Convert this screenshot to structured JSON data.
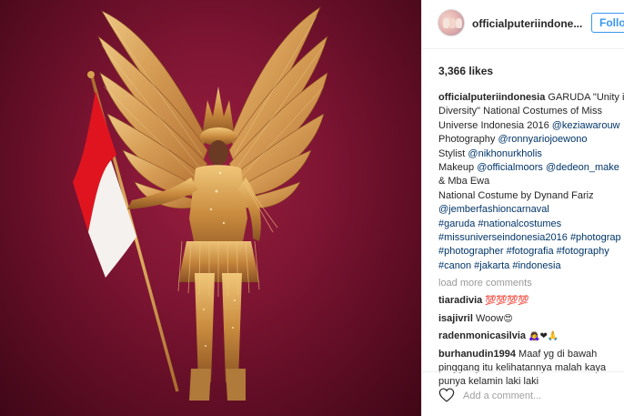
{
  "post": {
    "username": "officialputeriindone...",
    "follow_label": "Follow",
    "likes": "3,366 likes",
    "caption_lines": [
      [
        {
          "t": "officialputeriindonesia",
          "c": "b"
        },
        {
          "t": " GARUDA \"Unity in",
          "c": ""
        }
      ],
      [
        {
          "t": "Diversity\" National Costumes of Miss",
          "c": ""
        }
      ],
      [
        {
          "t": "Universe Indonesia 2016 ",
          "c": ""
        },
        {
          "t": "@keziawarouw",
          "c": "link"
        }
      ],
      [
        {
          "t": "Photography ",
          "c": ""
        },
        {
          "t": "@ronnyariojoewono",
          "c": "link"
        }
      ],
      [
        {
          "t": "Stylist ",
          "c": ""
        },
        {
          "t": "@nikhonurkholis",
          "c": "link"
        }
      ],
      [
        {
          "t": "Makeup ",
          "c": ""
        },
        {
          "t": "@officialmoors",
          "c": "link"
        },
        {
          "t": " ",
          "c": ""
        },
        {
          "t": "@dedeon_make",
          "c": "link"
        }
      ],
      [
        {
          "t": "& Mba Ewa",
          "c": ""
        }
      ],
      [
        {
          "t": "National Costume by Dynand Fariz",
          "c": ""
        }
      ],
      [
        {
          "t": "@jemberfashioncarnaval",
          "c": "link"
        }
      ],
      [
        {
          "t": "#garuda",
          "c": "link"
        },
        {
          "t": " ",
          "c": ""
        },
        {
          "t": "#nationalcostumes",
          "c": "link"
        }
      ],
      [
        {
          "t": "#missuniverseindonesia2016",
          "c": "link"
        },
        {
          "t": " ",
          "c": ""
        },
        {
          "t": "#photograp",
          "c": "link"
        }
      ],
      [
        {
          "t": "#photographer",
          "c": "link"
        },
        {
          "t": " ",
          "c": ""
        },
        {
          "t": "#fotografia",
          "c": "link"
        },
        {
          "t": " ",
          "c": ""
        },
        {
          "t": "#fotography",
          "c": "link"
        }
      ],
      [
        {
          "t": "#canon",
          "c": "link"
        },
        {
          "t": " ",
          "c": ""
        },
        {
          "t": "#jakarta",
          "c": "link"
        },
        {
          "t": " ",
          "c": ""
        },
        {
          "t": "#indonesia",
          "c": "link"
        }
      ]
    ],
    "load_more": "load more comments",
    "comments": [
      {
        "user": "tiaradivia",
        "parts": [
          {
            "t": "💯💯💯💯",
            "c": "emo red"
          }
        ]
      },
      {
        "user": "isajivril",
        "parts": [
          {
            "t": "Woow",
            "c": ""
          },
          {
            "t": "😍",
            "c": "emo"
          }
        ]
      },
      {
        "user": "radenmonicasilvia",
        "parts": [
          {
            "t": "🙇‍♀️❤🙏",
            "c": "emo"
          }
        ]
      },
      {
        "user": "burhanudin1994",
        "parts": [
          {
            "t": "Maaf yg di bawah",
            "c": ""
          }
        ],
        "more": [
          "pinggang itu kelihatannya malah kaya",
          "punya kelamin laki laki"
        ]
      }
    ],
    "add_comment_placeholder": "Add a comment...",
    "icons": {
      "like": "heart-icon",
      "avatar": "profile-avatar"
    },
    "colors": {
      "link": "#003569",
      "follow": "#3897f0",
      "muted": "#999999",
      "background_photo": "#7e1533"
    }
  }
}
